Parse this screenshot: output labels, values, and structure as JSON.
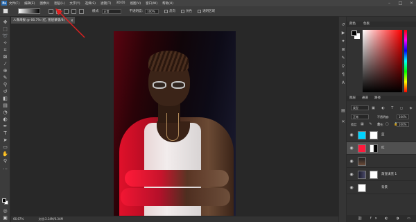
{
  "menubar": {
    "logo": "Ps",
    "items": [
      "文件(F)",
      "编辑(E)",
      "图像(I)",
      "图层(L)",
      "文字(Y)",
      "选择(S)",
      "滤镜(T)",
      "3D(D)",
      "视图(V)",
      "窗口(W)",
      "帮助(H)"
    ],
    "window_controls": [
      "–",
      "□",
      "×"
    ]
  },
  "options": {
    "mode_label": "模式:",
    "mode_value": "正常",
    "opacity_label": "不透明度:",
    "opacity_value": "100%",
    "reverse_label": "反向",
    "dither_label": "仿色",
    "transparency_label": "透明区域"
  },
  "document": {
    "tab_title": "人像海报 @ 66.7% (红, 图层蒙版/8) *",
    "close_glyph": "×"
  },
  "status": {
    "zoom": "66.67%",
    "doc_info": "文档:3.14M/6.34M"
  },
  "color_panel": {
    "tab_color": "颜色",
    "tab_swatches": "色板"
  },
  "layers_panel": {
    "tab_layers": "图层",
    "tab_channels": "通道",
    "tab_paths": "路径",
    "filter_kind": "类型",
    "filter_icons": "▣ ◐ T ◻ ◈",
    "blend_mode": "正常",
    "opacity_label": "不透明度:",
    "opacity_value": "100%",
    "lock_label": "锁定:",
    "lock_icons": "▦ ✎ ✥ ▢ 🔒",
    "fill_label": "填充:",
    "fill_value": "100%",
    "layers": [
      {
        "name": "蓝",
        "thumb_color": "#00d4ff",
        "selected": false
      },
      {
        "name": "红",
        "thumb_color": "#ff1a3c",
        "selected": true
      },
      {
        "name": "",
        "thumb_color": "#6b4a38",
        "selected": false
      },
      {
        "name": "渐变填充 1",
        "thumb_color": "#333333",
        "selected": false
      },
      {
        "name": "背景",
        "thumb_color": "#ffffff",
        "selected": false
      }
    ],
    "footer_icons": "⛓ fx ◐ ◑ ▭ ▤ 🗑"
  },
  "colors": {
    "accent_red": "#e8102a",
    "annotation_arrow": "#e02020",
    "panel_bg": "#323232"
  }
}
